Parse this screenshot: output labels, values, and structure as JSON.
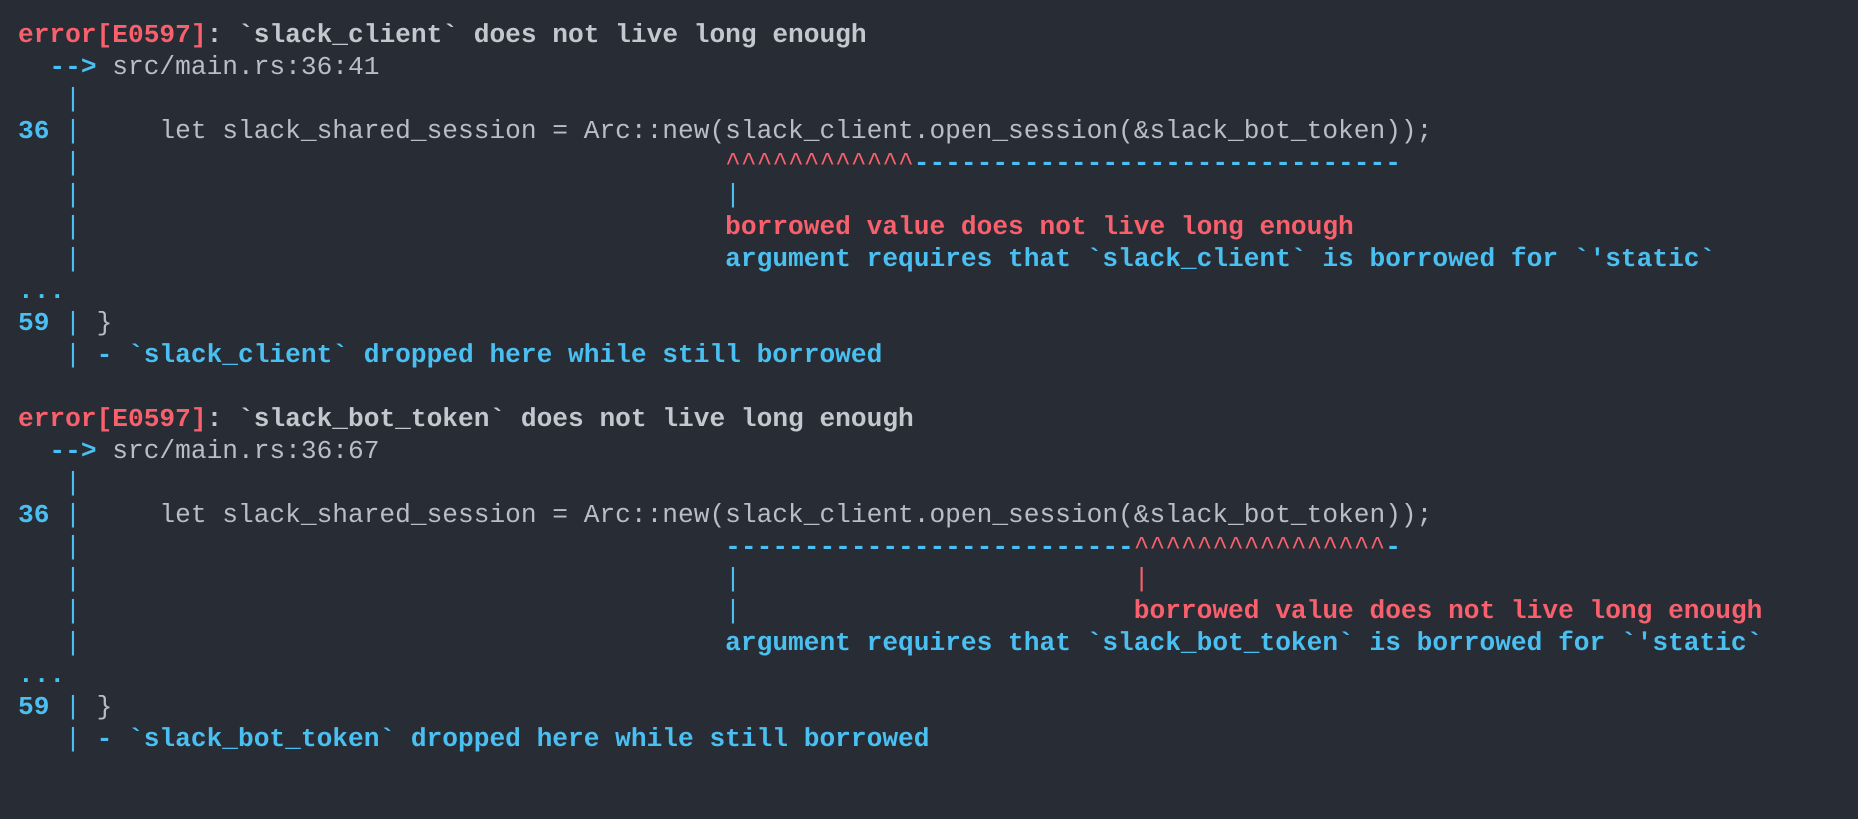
{
  "gutter_pipe": "|",
  "errors": [
    {
      "header_code": "error[E0597]",
      "header_message": ": `slack_client` does not live long enough",
      "arrow": "-->",
      "location": "src/main.rs:36:41",
      "line_number": "36",
      "source": "    let slack_shared_session = Arc::new(slack_client.open_session(&slack_bot_token));",
      "marker_primary": "^^^^^^^^^^^^",
      "marker_secondary": "-------------------------------",
      "primary_label": "borrowed value does not live long enough",
      "secondary_label": "argument requires that `slack_client` is borrowed for `'static`",
      "ellipsis": "...",
      "end_line_number": "59",
      "end_source": " }",
      "dropped_label": "- `slack_client` dropped here while still borrowed"
    },
    {
      "header_code": "error[E0597]",
      "header_message": ": `slack_bot_token` does not live long enough",
      "arrow": "-->",
      "location": "src/main.rs:36:67",
      "line_number": "36",
      "source": "    let slack_shared_session = Arc::new(slack_client.open_session(&slack_bot_token));",
      "marker_secondary_before": "--------------------------",
      "marker_primary": "^^^^^^^^^^^^^^^^",
      "marker_secondary_after": "-",
      "primary_label": "borrowed value does not live long enough",
      "secondary_label": "argument requires that `slack_bot_token` is borrowed for `'static`",
      "ellipsis": "...",
      "end_line_number": "59",
      "end_source": " }",
      "dropped_label": "- `slack_bot_token` dropped here while still borrowed"
    }
  ],
  "colors": {
    "background": "#282c34",
    "error": "#f7606c",
    "note": "#4ac0f2",
    "text": "#b9bec6"
  }
}
